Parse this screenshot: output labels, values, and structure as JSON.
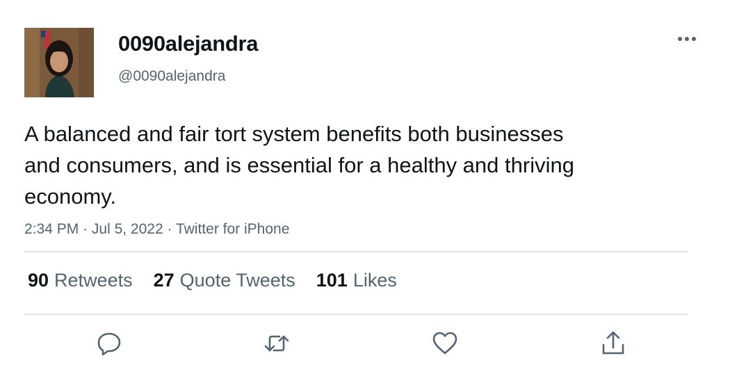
{
  "user": {
    "display_name": "0090alejandra",
    "handle": "@0090alejandra"
  },
  "tweet": {
    "text": "A balanced and fair tort system benefits both businesses and consumers, and is essential for a healthy and thriving economy.",
    "time": "2:34 PM",
    "date": "Jul 5, 2022",
    "source": "Twitter for iPhone",
    "separator": "·"
  },
  "stats": {
    "retweets_count": "90",
    "retweets_label": "Retweets",
    "quotes_count": "27",
    "quotes_label": "Quote Tweets",
    "likes_count": "101",
    "likes_label": "Likes"
  },
  "icons": {
    "more": "more-horizontal-icon",
    "reply": "reply-icon",
    "retweet": "retweet-icon",
    "like": "heart-icon",
    "share": "share-icon"
  },
  "colors": {
    "text_primary": "#0f1419",
    "text_secondary": "#536471",
    "divider": "#dfe3e6"
  }
}
